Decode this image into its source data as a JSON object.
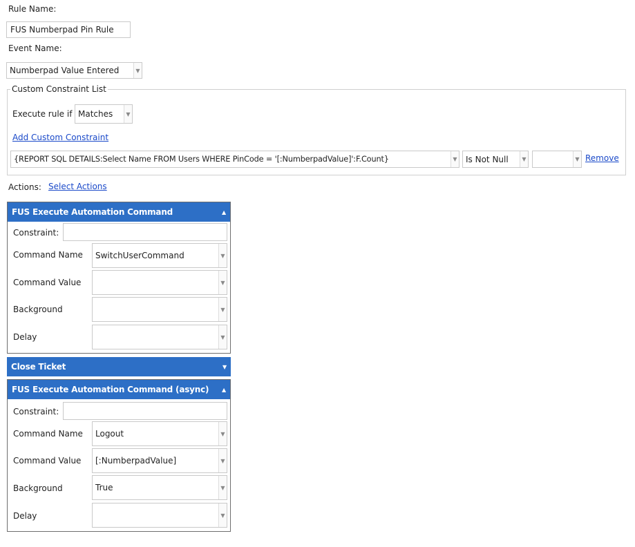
{
  "rule": {
    "name_label": "Rule Name:",
    "name_value": "FUS Numberpad Pin Rule",
    "event_label": "Event Name:",
    "event_value": "Numberpad Value Entered"
  },
  "constraints": {
    "legend": "Custom Constraint List",
    "execute_label": "Execute rule if",
    "execute_value": "Matches",
    "add_link": "Add Custom Constraint",
    "row": {
      "expression": "{REPORT SQL DETAILS:Select Name FROM Users WHERE PinCode = '[:NumberpadValue]':F.Count}",
      "operation": "Is Not Null",
      "value": "",
      "remove_link": "Remove"
    }
  },
  "actions": {
    "label": "Actions:",
    "select_link": "Select Actions",
    "panels": [
      {
        "title": "FUS Execute Automation Command",
        "expanded": true,
        "constraint_label": "Constraint:",
        "constraint_value": "",
        "fields": [
          {
            "label": "Command Name",
            "value": "SwitchUserCommand"
          },
          {
            "label": "Command Value",
            "value": ""
          },
          {
            "label": "Background",
            "value": ""
          },
          {
            "label": "Delay",
            "value": ""
          }
        ]
      },
      {
        "title": "Close Ticket",
        "expanded": false
      },
      {
        "title": "FUS Execute Automation Command (async)",
        "expanded": true,
        "constraint_label": "Constraint:",
        "constraint_value": "",
        "fields": [
          {
            "label": "Command Name",
            "value": "Logout"
          },
          {
            "label": "Command Value",
            "value": "[:NumberpadValue]"
          },
          {
            "label": "Background",
            "value": "True"
          },
          {
            "label": "Delay",
            "value": ""
          }
        ]
      }
    ]
  },
  "colors": {
    "panel_header": "#2d6fc6",
    "link": "#1a49c9"
  }
}
